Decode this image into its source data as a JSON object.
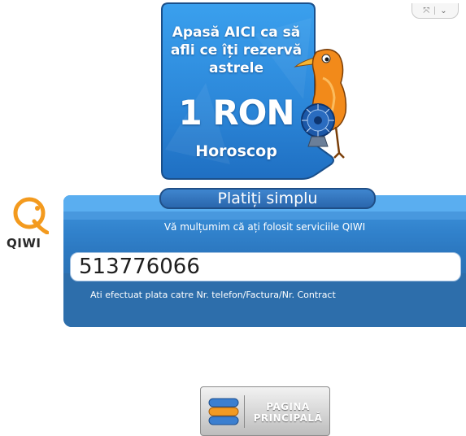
{
  "window_controls": {
    "resize_glyph": "⤧",
    "menu_glyph": "⌄"
  },
  "banner": {
    "line1": "Apasă AICI ca să",
    "line2": "afli ce îți rezervă",
    "line3": "astrele",
    "price": "1 RON",
    "label": "Horoscop",
    "mascot_icon": "kiwi-bird-zodiac-icon"
  },
  "logo": {
    "word": "QIWI",
    "icon": "qiwi-logo-icon"
  },
  "panel": {
    "title": "Platiți simplu",
    "thanks": "Vă mulțumim că ați folosit serviciile QIWI",
    "number": "513776066",
    "caption": "Ati efectuat plata catre Nr. telefon/Factura/Nr. Contract"
  },
  "home_button": {
    "line1": "PAGINA",
    "line2": "PRINCIPALĂ",
    "icon": "main-page-icon"
  },
  "colors": {
    "panel_blue": "#3182cc",
    "banner_blue": "#2f8be0",
    "accent_orange": "#f28a1a"
  }
}
